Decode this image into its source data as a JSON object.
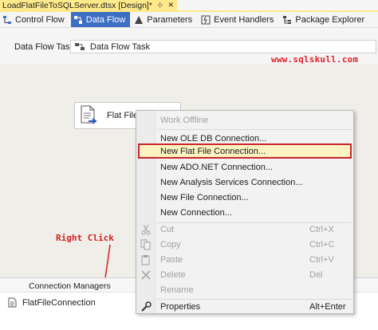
{
  "document_tab": {
    "title": "LoadFlatFileToSQLServer.dtsx [Design]*",
    "pin_glyph": "⊹",
    "close_glyph": "✕"
  },
  "designer_tabs": [
    {
      "label": "Control Flow",
      "icon": "control-flow-icon",
      "active": false
    },
    {
      "label": "Data Flow",
      "icon": "data-flow-icon",
      "active": true
    },
    {
      "label": "Parameters",
      "icon": "parameters-icon",
      "active": false
    },
    {
      "label": "Event Handlers",
      "icon": "event-handlers-icon",
      "active": false
    },
    {
      "label": "Package Explorer",
      "icon": "package-explorer-icon",
      "active": false
    }
  ],
  "task_bar": {
    "label": "Data Flow Task:",
    "selected": "Data Flow Task"
  },
  "watermark": "www.sqlskull.com",
  "component": {
    "label": "Flat File"
  },
  "annotation": {
    "right_click": "Right Click"
  },
  "connection_managers": {
    "header": "Connection Managers",
    "items": [
      {
        "label": "FlatFileConnection"
      }
    ]
  },
  "context_menu": {
    "items": [
      {
        "label": "Work Offline",
        "disabled": true
      },
      {
        "label": "New OLE DB Connection..."
      },
      {
        "label": "New Flat File Connection...",
        "highlighted": true
      },
      {
        "label": "New ADO.NET Connection..."
      },
      {
        "label": "New Analysis Services Connection..."
      },
      {
        "label": "New File Connection..."
      },
      {
        "label": "New Connection..."
      },
      {
        "label": "Cut",
        "shortcut": "Ctrl+X",
        "icon": "cut-icon",
        "disabled": true
      },
      {
        "label": "Copy",
        "shortcut": "Ctrl+C",
        "icon": "copy-icon",
        "disabled": true
      },
      {
        "label": "Paste",
        "shortcut": "Ctrl+V",
        "icon": "paste-icon",
        "disabled": true
      },
      {
        "label": "Delete",
        "shortcut": "Del",
        "icon": "delete-icon",
        "disabled": true
      },
      {
        "label": "Rename",
        "disabled": true
      },
      {
        "label": "Properties",
        "shortcut": "Alt+Enter",
        "icon": "properties-icon"
      }
    ]
  },
  "colors": {
    "tab_highlight": "#ffe98a",
    "active_tab": "#3c6fc4",
    "annotation_red": "#d42020",
    "menu_highlight_fill": "#fdf2c0",
    "menu_highlight_border": "#c9252b"
  }
}
